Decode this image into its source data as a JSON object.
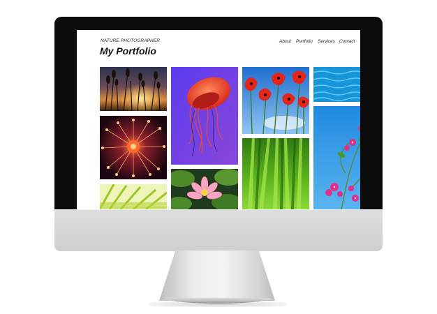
{
  "site": {
    "tagline": "NATURE PHOTOGRAPHER",
    "title": "My Portfolio",
    "nav": [
      "About",
      "Portfolio",
      "Services",
      "Contact"
    ]
  },
  "gallery": [
    {
      "name": "reeds-at-sunset"
    },
    {
      "name": "jellyfish"
    },
    {
      "name": "red-poppies"
    },
    {
      "name": "blue-water"
    },
    {
      "name": "orange-sea-anemone"
    },
    {
      "name": "green-grass-blades"
    },
    {
      "name": "pink-bougainvillea"
    },
    {
      "name": "pink-water-lily"
    },
    {
      "name": "palm-leaf"
    }
  ],
  "colors": {
    "bezel": "#0c0c0c",
    "chin": "#d6d6d6",
    "text": "#111111"
  }
}
